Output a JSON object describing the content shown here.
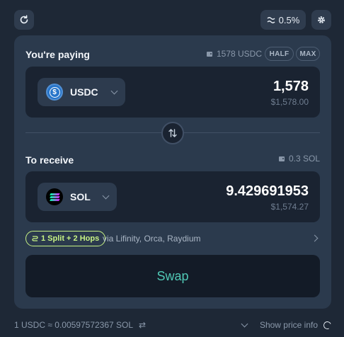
{
  "header": {
    "refresh_icon": "refresh-icon",
    "slippage": "0.5%",
    "settings_icon": "gear-icon"
  },
  "pay": {
    "label": "You're paying",
    "balance": "1578 USDC",
    "half_label": "HALF",
    "max_label": "MAX",
    "token": "USDC",
    "amount": "1,578",
    "usd_value": "$1,578.00"
  },
  "receive": {
    "label": "To receive",
    "balance": "0.3 SOL",
    "token": "SOL",
    "amount": "9.429691953",
    "usd_value": "$1,574.27"
  },
  "route": {
    "badge": "1 Split + 2 Hops",
    "via": "via Lifinity, Orca, Raydium"
  },
  "swap_label": "Swap",
  "footer": {
    "rate": "1 USDC ≈ 0.00597572367 SOL",
    "price_info_label": "Show price info"
  },
  "colors": {
    "background": "#1e2836",
    "card": "#2b3a4d",
    "accent_route": "#c7f284",
    "swap_text": "#50c8b5"
  }
}
